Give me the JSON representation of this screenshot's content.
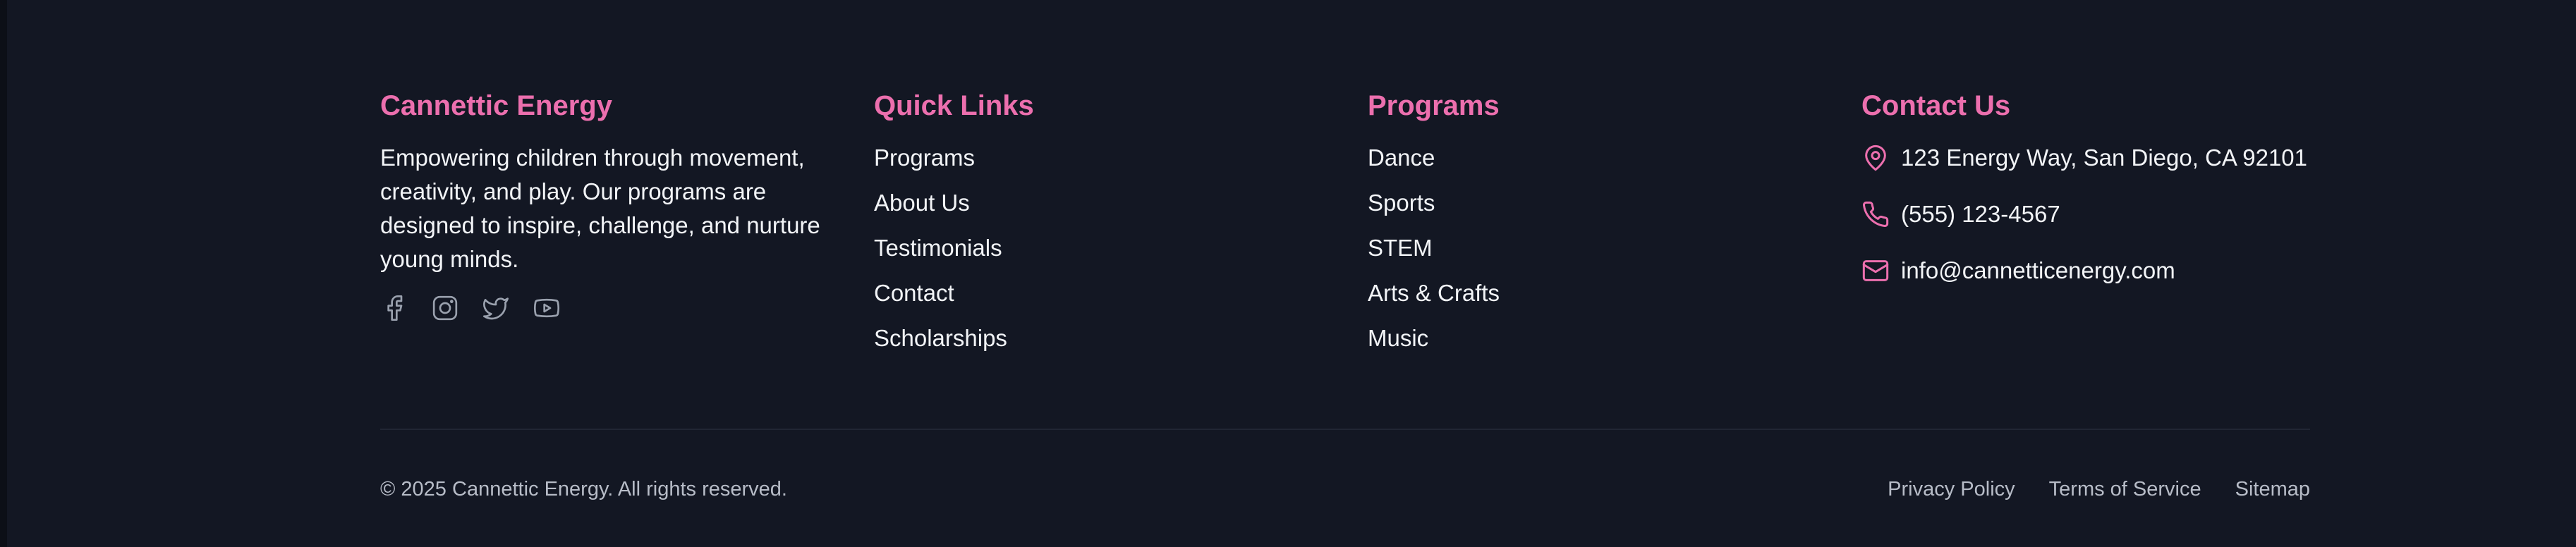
{
  "colors": {
    "background": "#131723",
    "accent": "#ec6fae",
    "text": "#f2f4f7",
    "muted": "#b7bcc7"
  },
  "brand": {
    "title": "Cannettic Energy",
    "description": "Empowering children through movement, creativity, and play. Our programs are designed to inspire, challenge, and nurture young minds.",
    "socials": [
      "facebook-icon",
      "instagram-icon",
      "twitter-icon",
      "youtube-icon"
    ]
  },
  "quick_links": {
    "title": "Quick Links",
    "items": [
      {
        "label": "Programs"
      },
      {
        "label": "About Us"
      },
      {
        "label": "Testimonials"
      },
      {
        "label": "Contact"
      },
      {
        "label": "Scholarships"
      }
    ]
  },
  "programs": {
    "title": "Programs",
    "items": [
      {
        "label": "Dance"
      },
      {
        "label": "Sports"
      },
      {
        "label": "STEM"
      },
      {
        "label": "Arts & Crafts"
      },
      {
        "label": "Music"
      }
    ]
  },
  "contact": {
    "title": "Contact Us",
    "address": "123 Energy Way, San Diego, CA 92101",
    "phone": "(555) 123-4567",
    "email": "info@cannetticenergy.com"
  },
  "bottom": {
    "copyright": "© 2025 Cannettic Energy. All rights reserved.",
    "links": [
      {
        "label": "Privacy Policy"
      },
      {
        "label": "Terms of Service"
      },
      {
        "label": "Sitemap"
      }
    ]
  }
}
